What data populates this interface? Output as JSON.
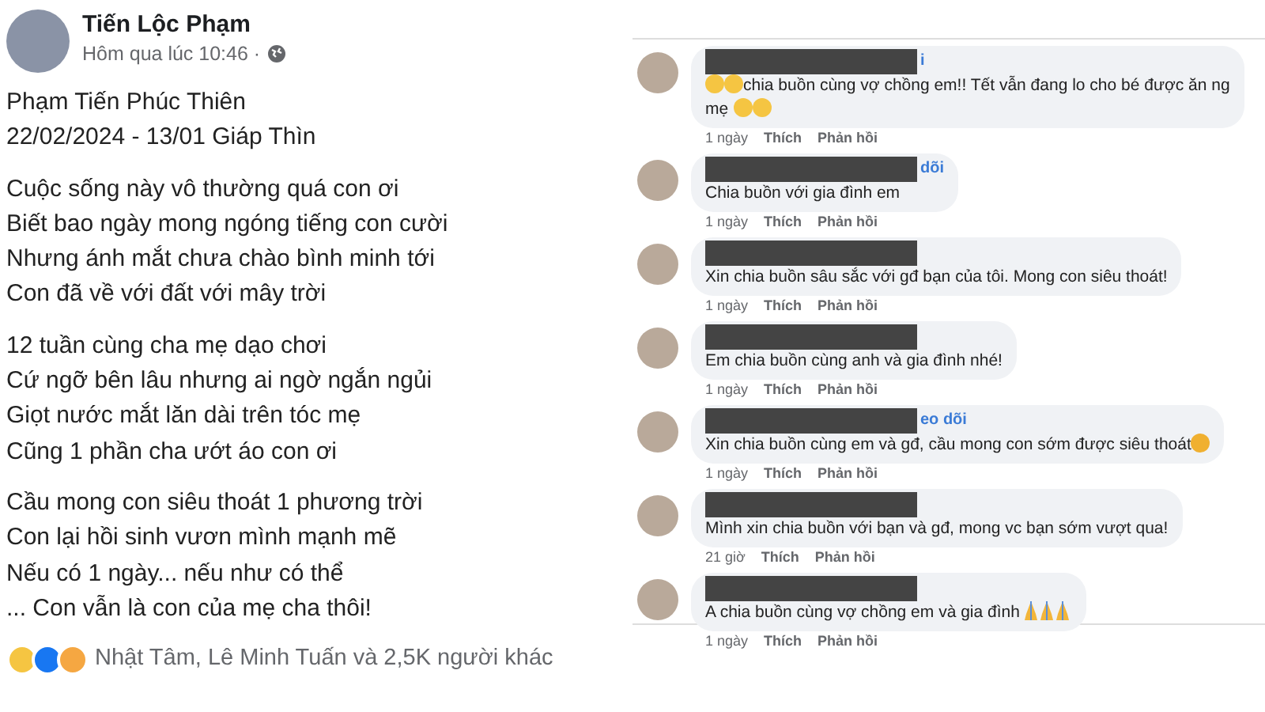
{
  "post": {
    "author": "Tiến Lộc Phạm",
    "time": "Hôm qua lúc 10:46 ·",
    "stanzas": [
      [
        "Phạm Tiến Phúc Thiên",
        "22/02/2024 - 13/01 Giáp Thìn"
      ],
      [
        "Cuộc sống này vô thường quá con ơi",
        "Biết bao ngày mong ngóng tiếng con cười",
        "Nhưng ánh mắt chưa chào bình minh tới",
        "Con đã về với đất với mây trời"
      ],
      [
        "12 tuần cùng cha mẹ dạo chơi",
        "Cứ ngỡ bên lâu nhưng ai ngờ ngắn ngủi",
        "Giọt nước mắt lăn dài trên tóc mẹ",
        "Cũng 1 phần cha ướt áo con ơi"
      ],
      [
        "Cầu mong con siêu thoát 1 phương trời",
        "Con lại hồi sinh vươn mình mạnh mẽ",
        "Nếu có 1 ngày... nếu như có thể",
        "... Con vẫn là con của mẹ cha thôi!"
      ]
    ],
    "reactions": {
      "icons": [
        {
          "kind": "sad"
        },
        {
          "kind": "like"
        },
        {
          "kind": "care"
        }
      ],
      "text": "Nhật Tâm, Lê Minh Tuấn và 2,5K người khác"
    }
  },
  "comments": [
    {
      "name_fragment": "i",
      "segments": [
        {
          "kind": "sad"
        },
        {
          "kind": "sad"
        },
        {
          "kind": "text",
          "text": "chia buồn cùng vợ chồng em!! Tết vẫn đang lo cho bé được ăn ng"
        },
        {
          "kind": "break"
        },
        {
          "kind": "text",
          "text": "mẹ "
        },
        {
          "kind": "sad"
        },
        {
          "kind": "sad"
        }
      ],
      "age": "1 ngày",
      "like": "Thích",
      "reply": "Phản hồi"
    },
    {
      "name_fragment": "dõi",
      "segments": [
        {
          "kind": "text",
          "text": "Chia buồn với gia đình em"
        }
      ],
      "age": "1 ngày",
      "like": "Thích",
      "reply": "Phản hồi"
    },
    {
      "segments": [
        {
          "kind": "text",
          "text": "Xin chia buồn sâu sắc với gđ bạn của tôi. Mong con siêu thoát!"
        }
      ],
      "age": "1 ngày",
      "like": "Thích",
      "reply": "Phản hồi"
    },
    {
      "segments": [
        {
          "kind": "text",
          "text": "Em chia buồn cùng anh và gia đình nhé!"
        }
      ],
      "age": "1 ngày",
      "like": "Thích",
      "reply": "Phản hồi"
    },
    {
      "name_fragment": "eo dõi",
      "segments": [
        {
          "kind": "text",
          "text": "Xin chia buồn cùng em và gđ, cầu mong con sớm được siêu thoát"
        },
        {
          "kind": "cry"
        }
      ],
      "age": "1 ngày",
      "like": "Thích",
      "reply": "Phản hồi"
    },
    {
      "segments": [
        {
          "kind": "text",
          "text": "Mình xin chia buồn với bạn và gđ, mong vc bạn sớm vượt qua!"
        }
      ],
      "age": "21 giờ",
      "like": "Thích",
      "reply": "Phản hồi"
    },
    {
      "segments": [
        {
          "kind": "text",
          "text": "A chia buồn cùng vợ chồng em và gia đình "
        },
        {
          "kind": "pray"
        },
        {
          "kind": "pray"
        },
        {
          "kind": "pray"
        }
      ],
      "age": "1 ngày",
      "like": "Thích",
      "reply": "Phản hồi"
    }
  ]
}
